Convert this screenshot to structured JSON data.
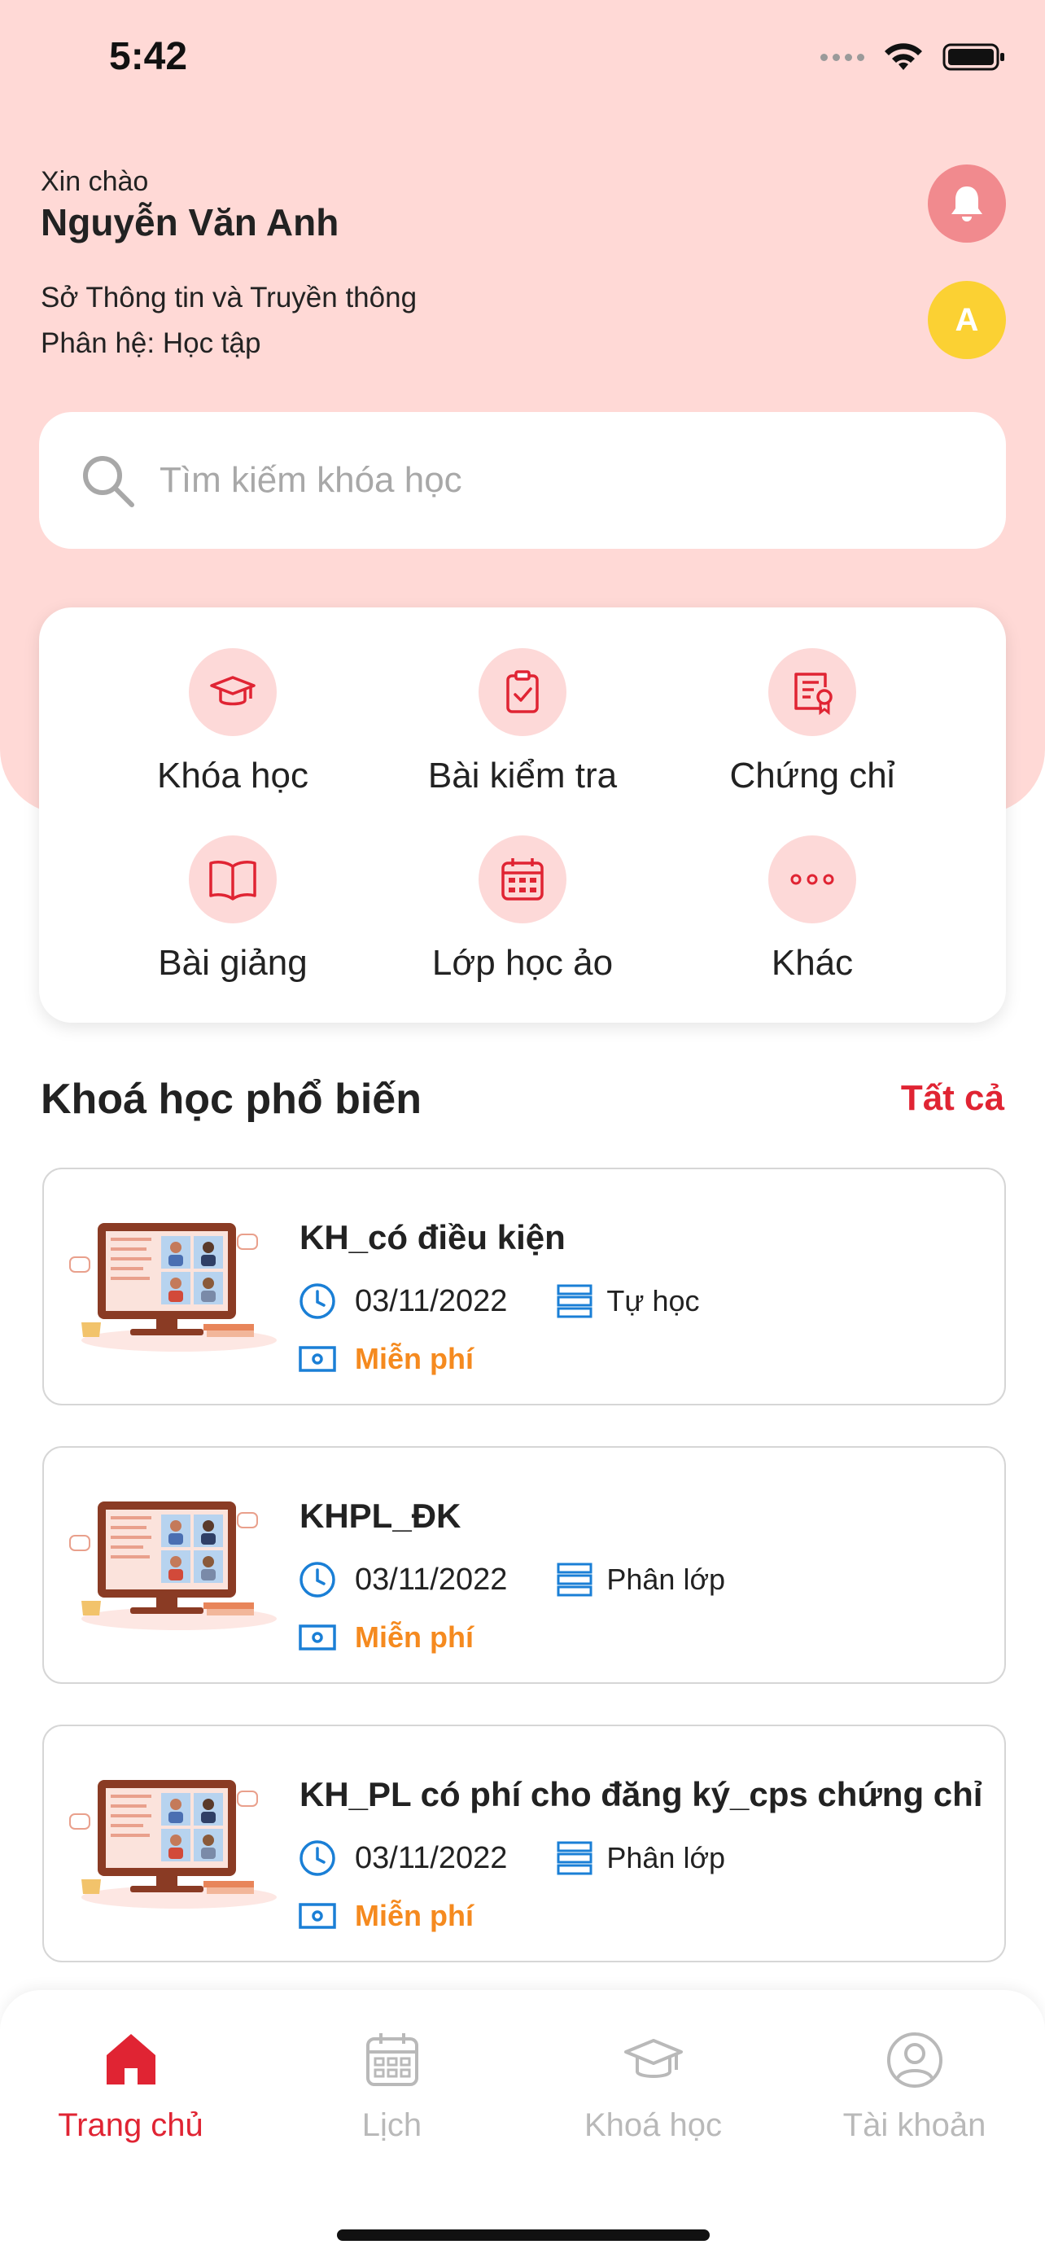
{
  "status_bar": {
    "time": "5:42"
  },
  "header": {
    "greeting": "Xin chào",
    "user_name": "Nguyễn Văn Anh",
    "organization": "Sở Thông tin và Truyền thông",
    "module": "Phân hệ: Học tập",
    "avatar_initial": "A"
  },
  "search": {
    "placeholder": "Tìm kiếm khóa học"
  },
  "features": [
    {
      "label": "Khóa học",
      "icon": "graduation-cap-icon"
    },
    {
      "label": "Bài kiểm tra",
      "icon": "clipboard-check-icon"
    },
    {
      "label": "Chứng chỉ",
      "icon": "certificate-icon"
    },
    {
      "label": "Bài giảng",
      "icon": "open-book-icon"
    },
    {
      "label": "Lớp học ảo",
      "icon": "calendar-icon"
    },
    {
      "label": "Khác",
      "icon": "more-dots-icon"
    }
  ],
  "popular": {
    "title": "Khoá học phổ biến",
    "see_all": "Tất cả",
    "courses": [
      {
        "title": "KH_có điều kiện",
        "date": "03/11/2022",
        "type": "Tự học",
        "price": "Miễn phí"
      },
      {
        "title": "KHPL_ĐK",
        "date": "03/11/2022",
        "type": "Phân lớp",
        "price": "Miễn phí"
      },
      {
        "title": "KH_PL  có phí cho đăng ký_cps chứng chỉ",
        "date": "03/11/2022",
        "type": "Phân lớp",
        "price": "Miễn phí"
      }
    ]
  },
  "bottom_nav": [
    {
      "label": "Trang chủ",
      "icon": "home-icon",
      "active": true
    },
    {
      "label": "Lịch",
      "icon": "calendar-icon",
      "active": false
    },
    {
      "label": "Khoá học",
      "icon": "graduation-cap-icon",
      "active": false
    },
    {
      "label": "Tài khoản",
      "icon": "account-icon",
      "active": false
    }
  ],
  "colors": {
    "header_bg": "#ffd9d6",
    "accent_red": "#e02433",
    "price_orange": "#f58a1f",
    "icon_blue": "#1a7fd6",
    "avatar_yellow": "#fbd133"
  }
}
